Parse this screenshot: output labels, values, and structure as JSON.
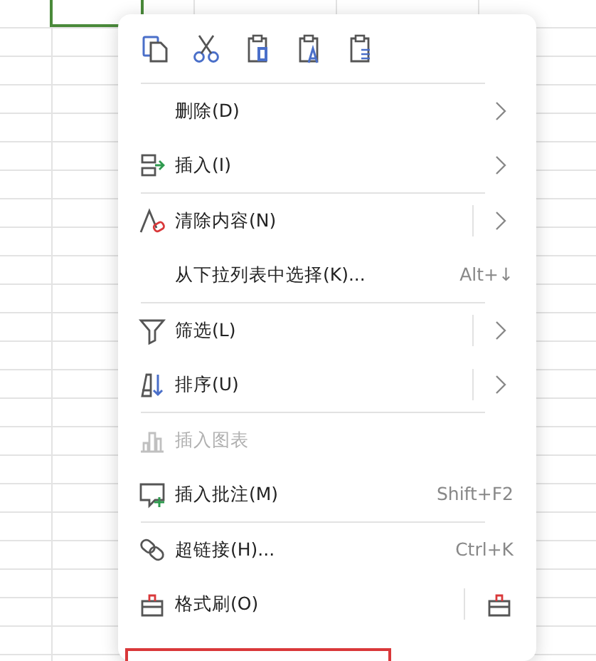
{
  "toolbar": [
    {
      "kind": "copy"
    },
    {
      "kind": "cut"
    },
    {
      "kind": "paste"
    },
    {
      "kind": "paste-text"
    },
    {
      "kind": "paste-format"
    }
  ],
  "menu_items": [
    {
      "kind": "none",
      "label": "删除(D)",
      "submenu": true,
      "split": false,
      "disabled": false,
      "separator_after": false
    },
    {
      "kind": "insert",
      "label": "插入(I)",
      "submenu": true,
      "split": false,
      "disabled": false,
      "separator_after": true
    },
    {
      "kind": "clear",
      "label": "清除内容(N)",
      "submenu": true,
      "split": true,
      "disabled": false,
      "separator_after": false
    },
    {
      "kind": "none",
      "label": "从下拉列表中选择(K)...",
      "shortcut": "Alt+↓",
      "submenu": false,
      "split": false,
      "disabled": false,
      "separator_after": true
    },
    {
      "kind": "filter",
      "label": "筛选(L)",
      "submenu": true,
      "split": true,
      "disabled": false,
      "separator_after": false
    },
    {
      "kind": "sort",
      "label": "排序(U)",
      "submenu": true,
      "split": true,
      "disabled": false,
      "separator_after": true
    },
    {
      "kind": "chart",
      "label": "插入图表",
      "submenu": false,
      "split": false,
      "disabled": true,
      "separator_after": false
    },
    {
      "kind": "comment",
      "label": "插入批注(M)",
      "shortcut": "Shift+F2",
      "submenu": false,
      "split": false,
      "disabled": false,
      "separator_after": true
    },
    {
      "kind": "link",
      "label": "超链接(H)...",
      "shortcut": "Ctrl+K",
      "submenu": false,
      "split": false,
      "disabled": false,
      "separator_after": false
    },
    {
      "kind": "brush",
      "label": "格式刷(O)",
      "submenu": false,
      "split": true,
      "split_button": true,
      "disabled": false,
      "separator_after": false
    }
  ]
}
